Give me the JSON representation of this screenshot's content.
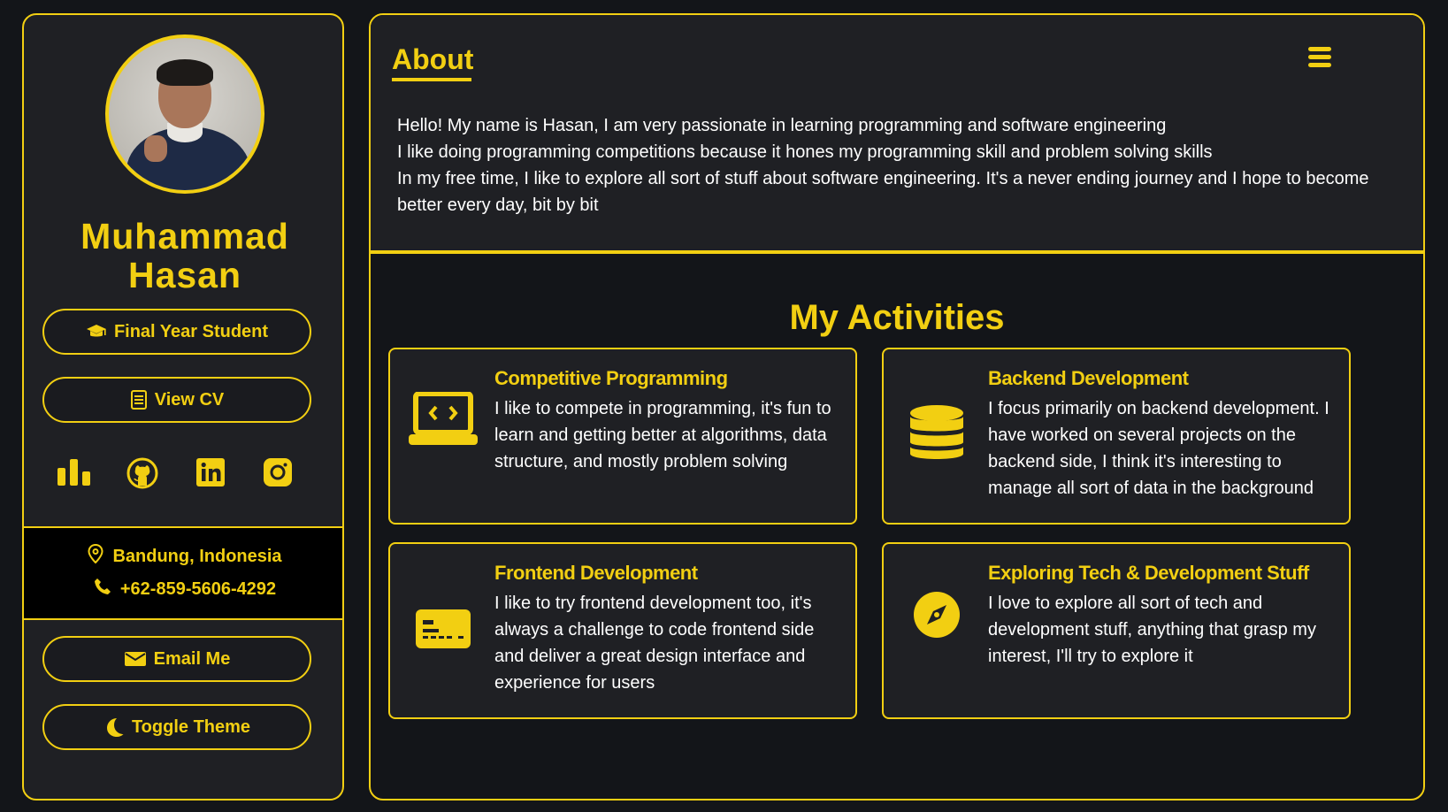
{
  "profile": {
    "name": "Muhammad Hasan",
    "status_label": "Final Year Student",
    "cv_label": "View CV",
    "location": "Bandung, Indonesia",
    "phone": "+62-859-5606-4292",
    "email_label": "Email Me",
    "theme_label": "Toggle Theme"
  },
  "socials": [
    {
      "icon": "stats-icon"
    },
    {
      "icon": "github-icon"
    },
    {
      "icon": "linkedin-icon"
    },
    {
      "icon": "instagram-icon"
    }
  ],
  "about": {
    "title": "About",
    "lines": [
      "Hello! My name is Hasan, I am very passionate in learning programming and software engineering",
      "I like doing programming competitions because it hones my programming skill and problem solving skills",
      "In my free time, I like to explore all sort of stuff about software engineering. It's a never ending journey and I hope to become better every day, bit by bit"
    ]
  },
  "activities": {
    "title": "My Activities",
    "items": [
      {
        "title": "Competitive Programming",
        "text": "I like to compete in programming, it's fun to learn and getting better at algorithms, data structure, and mostly problem solving",
        "icon": "laptop-code-icon"
      },
      {
        "title": "Backend Development",
        "text": "I focus primarily on backend development. I have worked on several projects on the backend side, I think it's interesting to manage all sort of data in the background",
        "icon": "database-icon"
      },
      {
        "title": "Frontend Development",
        "text": "I like to try frontend development too, it's always a challenge to code frontend side and deliver a great design interface and experience for users",
        "icon": "credit-card-icon"
      },
      {
        "title": "Exploring Tech & Development Stuff",
        "text": "I love to explore all sort of tech and development stuff, anything that grasp my interest, I'll try to explore it",
        "icon": "compass-icon"
      }
    ]
  },
  "colors": {
    "accent": "#f2cf12",
    "panel": "#1f2024",
    "background": "#131519"
  }
}
